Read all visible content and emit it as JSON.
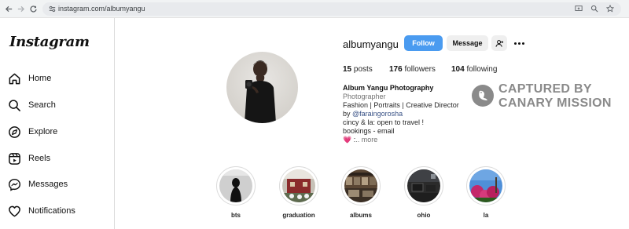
{
  "browser": {
    "url": "instagram.com/albumyangu"
  },
  "sidebar": {
    "logo": "Instagram",
    "items": [
      {
        "label": "Home"
      },
      {
        "label": "Search"
      },
      {
        "label": "Explore"
      },
      {
        "label": "Reels"
      },
      {
        "label": "Messages"
      },
      {
        "label": "Notifications"
      }
    ]
  },
  "profile": {
    "username": "albumyangu",
    "follow_label": "Follow",
    "message_label": "Message",
    "stats": {
      "posts_count": "15",
      "posts_label": "posts",
      "followers_count": "176",
      "followers_label": "followers",
      "following_count": "104",
      "following_label": "following"
    },
    "bio": {
      "name": "Album Yangu Photography",
      "category": "Photographer",
      "line1": "Fashion | Portraits | Creative Director",
      "by_prefix": "by ",
      "mention": "@faraingorosha",
      "line3": "cincy & la: open to travel !",
      "line4": "bookings - email",
      "line5_prefix": "💗 :",
      "more": ".. more"
    }
  },
  "watermark": {
    "line1": "CAPTURED BY",
    "line2": "CANARY MISSION"
  },
  "highlights": [
    {
      "label": "bts"
    },
    {
      "label": "graduation"
    },
    {
      "label": "albums"
    },
    {
      "label": "ohio"
    },
    {
      "label": "la"
    }
  ],
  "colors": {
    "follow_button": "#4a9bf0",
    "message_button": "#efefef",
    "mention_link": "#385185",
    "watermark": "#8a8a8a"
  }
}
